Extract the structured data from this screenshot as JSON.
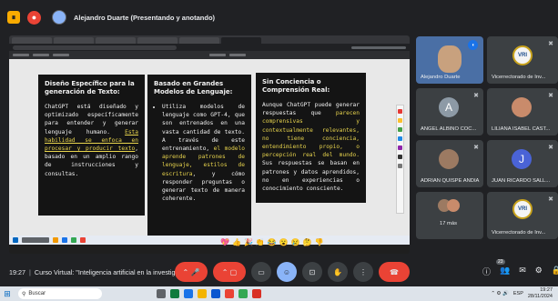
{
  "topbar": {
    "title": "Alejandro Duarte (Presentando y anotando)"
  },
  "slide": {
    "cards": [
      {
        "title": "Diseño Específico para la generación de Texto:",
        "text_a": "ChatGPT está diseñado y optimizado específicamente para entender y generar lenguaje humano. ",
        "text_hl": "Esta habilidad se enfoca en procesar y producir texto",
        "text_b": ", basado en un amplio rango de instrucciones y consultas."
      },
      {
        "title": "Basado en Grandes Modelos de Lenguaje:",
        "text_a": "Utiliza modelos de lenguaje como GPT-4, que son entrenados en una vasta cantidad de texto. A través de este entrenamiento, ",
        "text_hl": "el modelo aprende patrones de lenguaje, estilos de escritura",
        "text_b": ", y cómo responder preguntas o generar texto de manera coherente."
      },
      {
        "title": "Sin Conciencia o Comprensión Real:",
        "text_a": "Aunque ChatGPT puede generar respuestas que ",
        "text_hl": "parecen comprensivas y contextualmente relevantes, no tiene conciencia, entendimiento propio, o percepción real del mundo.",
        "text_b": " Sus respuestas se basan en patrones y datos aprendidos, no en experiencias o conocimiento consciente."
      }
    ]
  },
  "participants": [
    {
      "name": "Alejandro Duarte",
      "type": "video"
    },
    {
      "name": "Vicerrectorado de Inv...",
      "type": "logo",
      "logo_text": "VRI"
    },
    {
      "name": "ANGEL ALBINO COC...",
      "type": "initial",
      "initial": "A",
      "color": "#8d9aa6"
    },
    {
      "name": "LILIANA ISABEL CAST...",
      "type": "photo",
      "color": "#c98b6b"
    },
    {
      "name": "ADRIAN QUISPE ANDIA",
      "type": "photo",
      "color": "#9c7a62"
    },
    {
      "name": "JUAN RICARDO SALL...",
      "type": "initial",
      "initial": "J",
      "color": "#4a63d6"
    },
    {
      "name": "17 más",
      "type": "group"
    },
    {
      "name": "Vicerrectorado de Inv...",
      "type": "logo",
      "logo_text": "VRI"
    }
  ],
  "reactions": [
    "💖",
    "👍",
    "🎉",
    "👏",
    "😂",
    "😮",
    "😢",
    "🤔",
    "👎"
  ],
  "controls": {
    "time": "19:27",
    "meeting_title": "Curso Virtual: \"Inteligencia artificial en la investig...",
    "people_count": "23"
  },
  "taskbar": {
    "search_placeholder": "Buscar",
    "lang": "ESP",
    "time": "19:27",
    "date": "28/11/2024"
  }
}
